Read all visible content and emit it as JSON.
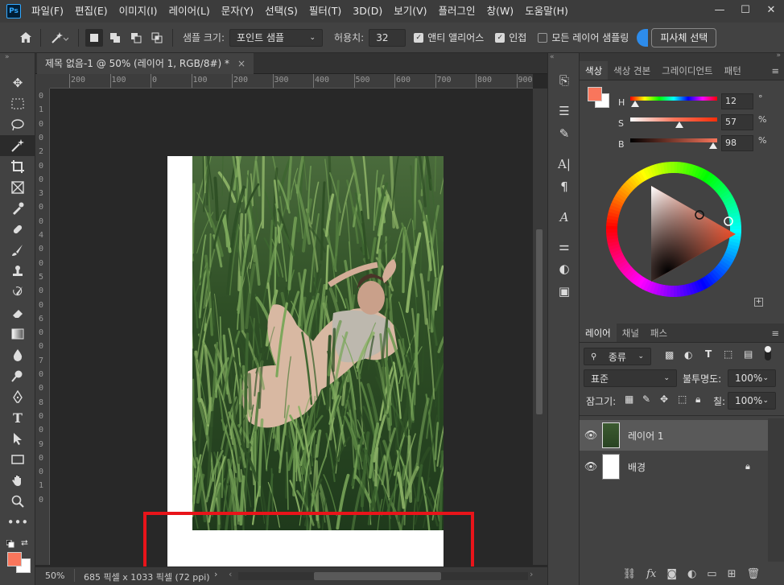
{
  "app": {
    "logo": "Ps"
  },
  "menu": [
    "파일(F)",
    "편집(E)",
    "이미지(I)",
    "레이어(L)",
    "문자(Y)",
    "선택(S)",
    "필터(T)",
    "3D(D)",
    "보기(V)",
    "플러그인",
    "창(W)",
    "도움말(H)"
  ],
  "window_controls": {
    "min": "—",
    "max": "☐",
    "close": "✕"
  },
  "options": {
    "sample_size_label": "샘플 크기:",
    "sample_size_value": "포인트 샘플",
    "tolerance_label": "허용치:",
    "tolerance_value": "32",
    "antialias_label": "앤티 앨리어스",
    "contiguous_label": "인접",
    "all_layers_label": "모든 레이어 샘플링",
    "select_subject_label": "피사체 선택"
  },
  "document": {
    "tab_title": "제목 없음-1 @ 50% (레이어 1, RGB/8#) *",
    "zoom": "50%",
    "doc_info": "685 픽셀 x 1033 픽셀 (72 ppi)",
    "ruler_h": [
      "200",
      "100",
      "0",
      "100",
      "200",
      "300",
      "400",
      "500",
      "600",
      "700",
      "800",
      "900"
    ],
    "ruler_v": [
      "0",
      "1",
      "0",
      "0",
      "2",
      "0",
      "0",
      "3",
      "0",
      "0",
      "4",
      "0",
      "0",
      "5",
      "0",
      "0",
      "6",
      "0",
      "0",
      "7",
      "0",
      "0",
      "8",
      "0",
      "0",
      "9",
      "0",
      "0",
      "1",
      "0"
    ]
  },
  "color_panel": {
    "tabs": [
      "색상",
      "색상 견본",
      "그레이디언트",
      "패턴"
    ],
    "h_label": "H",
    "h_value": "12",
    "h_unit": "°",
    "s_label": "S",
    "s_value": "57",
    "s_unit": "%",
    "b_label": "B",
    "b_value": "98",
    "b_unit": "%",
    "foreground": "#f9765c",
    "background": "#ffffff"
  },
  "layers_panel": {
    "tabs": [
      "레이어",
      "채널",
      "패스"
    ],
    "filter_label": "종류",
    "blend_mode": "표준",
    "opacity_label": "불투명도:",
    "opacity_value": "100%",
    "lock_label": "잠그기:",
    "fill_label": "칠:",
    "fill_value": "100%",
    "layers": [
      {
        "name": "레이어 1",
        "selected": true
      },
      {
        "name": "배경",
        "locked": true
      }
    ]
  },
  "annotation_color": "#e8141a"
}
